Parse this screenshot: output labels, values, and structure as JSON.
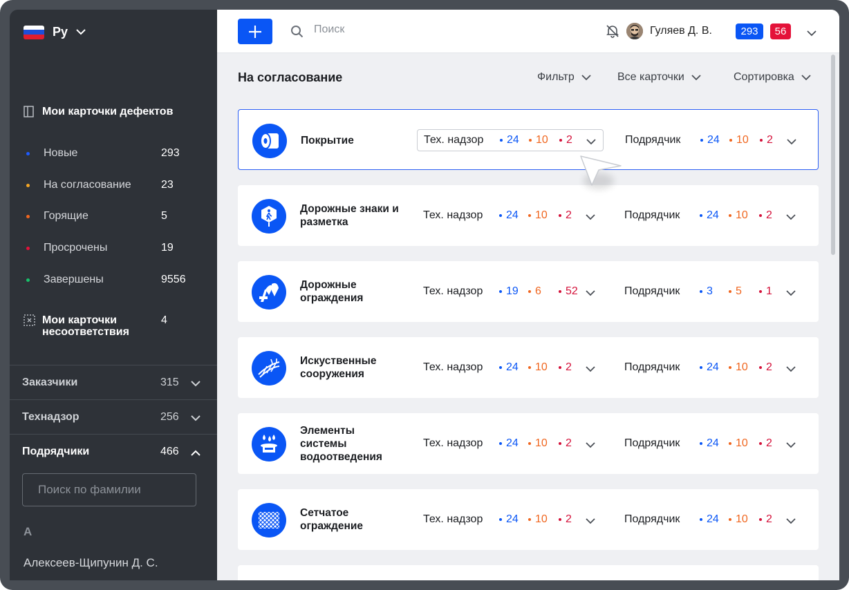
{
  "sidebar": {
    "language": {
      "label": "Ру",
      "flag_colors": [
        "#ffffff",
        "#1d4ed8",
        "#e11d2e"
      ]
    },
    "my_defect_cards": {
      "title": "Мои карточки дефектов",
      "items": [
        {
          "label": "Новые",
          "count": "293",
          "color": "#1e5bff"
        },
        {
          "label": "На согласование",
          "count": "23",
          "color": "#f5a623"
        },
        {
          "label": "Горящие",
          "count": "5",
          "color": "#f0661f"
        },
        {
          "label": "Просрочены",
          "count": "19",
          "color": "#e4123a"
        },
        {
          "label": "Завершены",
          "count": "9556",
          "color": "#18c26b"
        }
      ]
    },
    "nonconformity": {
      "title": "Мои карточки несоответствия",
      "count": "4"
    },
    "groups": [
      {
        "label": "Заказчики",
        "count": "315",
        "expanded": false
      },
      {
        "label": "Технадзор",
        "count": "256",
        "expanded": false
      },
      {
        "label": "Подрядчики",
        "count": "466",
        "expanded": true
      }
    ],
    "surname_search_placeholder": "Поиск по фамилии",
    "letter": "А",
    "person": "Алексеев-Щипунин Д. С."
  },
  "topbar": {
    "search_placeholder": "Поиск",
    "user_name": "Гуляев Д. В.",
    "badge_blue": "293",
    "badge_red": "56"
  },
  "header": {
    "title": "На согласование",
    "filter": "Фильтр",
    "all_cards": "Все карточки",
    "sort": "Сортировка"
  },
  "cards": [
    {
      "title": "Покрытие",
      "icon": "roll-icon",
      "tn": {
        "label": "Тех. надзор",
        "blue": "24",
        "orange": "10",
        "red": "2"
      },
      "pd": {
        "label": "Подрядчик",
        "blue": "24",
        "orange": "10",
        "red": "2"
      }
    },
    {
      "title": "Дорожные знаки и разметка",
      "icon": "road-sign-icon",
      "tn": {
        "label": "Тех. надзор",
        "blue": "24",
        "orange": "10",
        "red": "2"
      },
      "pd": {
        "label": "Подрядчик",
        "blue": "24",
        "orange": "10",
        "red": "2"
      }
    },
    {
      "title": "Дорожные ограждения",
      "icon": "barrier-icon",
      "tn": {
        "label": "Тех. надзор",
        "blue": "19",
        "orange": "6",
        "red": "52"
      },
      "pd": {
        "label": "Подрядчик",
        "blue": "3",
        "orange": "5",
        "red": "1"
      }
    },
    {
      "title": "Искуственные сооружения",
      "icon": "bridge-icon",
      "tn": {
        "label": "Тех. надзор",
        "blue": "24",
        "orange": "10",
        "red": "2"
      },
      "pd": {
        "label": "Подрядчик",
        "blue": "24",
        "orange": "10",
        "red": "2"
      }
    },
    {
      "title": "Элементы системы водоотведения",
      "icon": "drainage-icon",
      "tn": {
        "label": "Тех. надзор",
        "blue": "24",
        "orange": "10",
        "red": "2"
      },
      "pd": {
        "label": "Подрядчик",
        "blue": "24",
        "orange": "10",
        "red": "2"
      }
    },
    {
      "title": "Сетчатое ограждение",
      "icon": "mesh-fence-icon",
      "tn": {
        "label": "Тех. надзор",
        "blue": "24",
        "orange": "10",
        "red": "2"
      },
      "pd": {
        "label": "Подрядчик",
        "blue": "24",
        "orange": "10",
        "red": "2"
      }
    }
  ],
  "colors": {
    "accent": "#0a56f5",
    "alert": "#e4123a",
    "warning": "#f0661f"
  }
}
